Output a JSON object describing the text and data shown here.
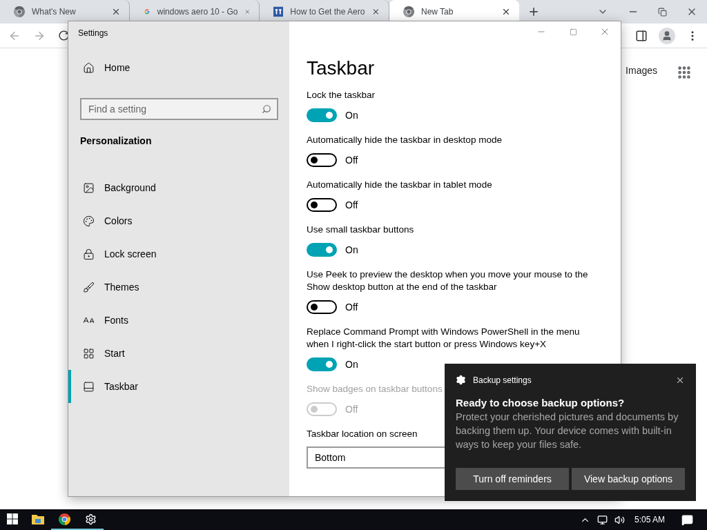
{
  "browser": {
    "tabs": [
      {
        "title": "What's New",
        "kind": "chrome",
        "selected": false
      },
      {
        "title": "windows aero 10 - Go",
        "kind": "google",
        "selected": false
      },
      {
        "title": "How to Get the Aero",
        "kind": "site",
        "selected": false
      },
      {
        "title": "New Tab",
        "kind": "chrome",
        "selected": true
      }
    ],
    "page": {
      "link": "Images"
    }
  },
  "settings": {
    "title": "Settings",
    "home": "Home",
    "search": {
      "placeholder": "Find a setting"
    },
    "section": "Personalization",
    "nav": [
      {
        "label": "Background",
        "kind": "background",
        "selected": false
      },
      {
        "label": "Colors",
        "kind": "colors",
        "selected": false
      },
      {
        "label": "Lock screen",
        "kind": "lock",
        "selected": false
      },
      {
        "label": "Themes",
        "kind": "themes",
        "selected": false
      },
      {
        "label": "Fonts",
        "kind": "fonts",
        "selected": false
      },
      {
        "label": "Start",
        "kind": "start",
        "selected": false
      },
      {
        "label": "Taskbar",
        "kind": "taskbar",
        "selected": true
      }
    ],
    "page_title": "Taskbar",
    "options": [
      {
        "label": "Lock the taskbar",
        "on": true,
        "disabled": false,
        "state": "On"
      },
      {
        "label": "Automatically hide the taskbar in desktop mode",
        "on": false,
        "disabled": false,
        "state": "Off"
      },
      {
        "label": "Automatically hide the taskbar in tablet mode",
        "on": false,
        "disabled": false,
        "state": "Off"
      },
      {
        "label": "Use small taskbar buttons",
        "on": true,
        "disabled": false,
        "state": "On"
      },
      {
        "label": "Use Peek to preview the desktop when you move your mouse to the Show desktop button at the end of the taskbar",
        "on": false,
        "disabled": false,
        "state": "Off"
      },
      {
        "label": "Replace Command Prompt with Windows PowerShell in the menu when I right-click the start button or press Windows key+X",
        "on": true,
        "disabled": false,
        "state": "On"
      },
      {
        "label": "Show badges on taskbar buttons",
        "on": false,
        "disabled": true,
        "state": "Off"
      }
    ],
    "location": {
      "label": "Taskbar location on screen",
      "value": "Bottom"
    }
  },
  "toast": {
    "app": "Backup settings",
    "heading": "Ready to choose backup options?",
    "body": "Protect your cherished pictures and documents by backing them up. Your device comes with built-in ways to keep your files safe.",
    "buttons": [
      "Turn off reminders",
      "View backup options"
    ]
  },
  "taskbar": {
    "apps": [
      {
        "kind": "explorer",
        "running": false
      },
      {
        "kind": "chrome",
        "running": true
      },
      {
        "kind": "settings",
        "running": true
      }
    ],
    "time": "5:05 AM"
  }
}
